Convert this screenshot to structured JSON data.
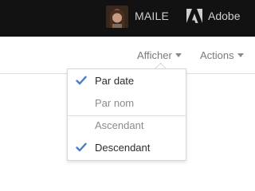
{
  "header": {
    "user_name": "MAILE",
    "brand_name": "Adobe",
    "avatar_icon": "user-avatar-photo",
    "brand_icon": "adobe-logo-icon"
  },
  "toolbar": {
    "view_label": "Afficher",
    "actions_label": "Actions"
  },
  "sort_menu": {
    "items": [
      {
        "label": "Par date",
        "checked": true
      },
      {
        "label": "Par nom",
        "checked": false
      },
      {
        "label": "Ascendant",
        "checked": false
      },
      {
        "label": "Descendant",
        "checked": true
      }
    ]
  },
  "colors": {
    "header_bg": "#121212",
    "checkmark": "#4a7fc0",
    "text_muted": "#8b8b8b",
    "text_selected": "#2c2c2c"
  }
}
